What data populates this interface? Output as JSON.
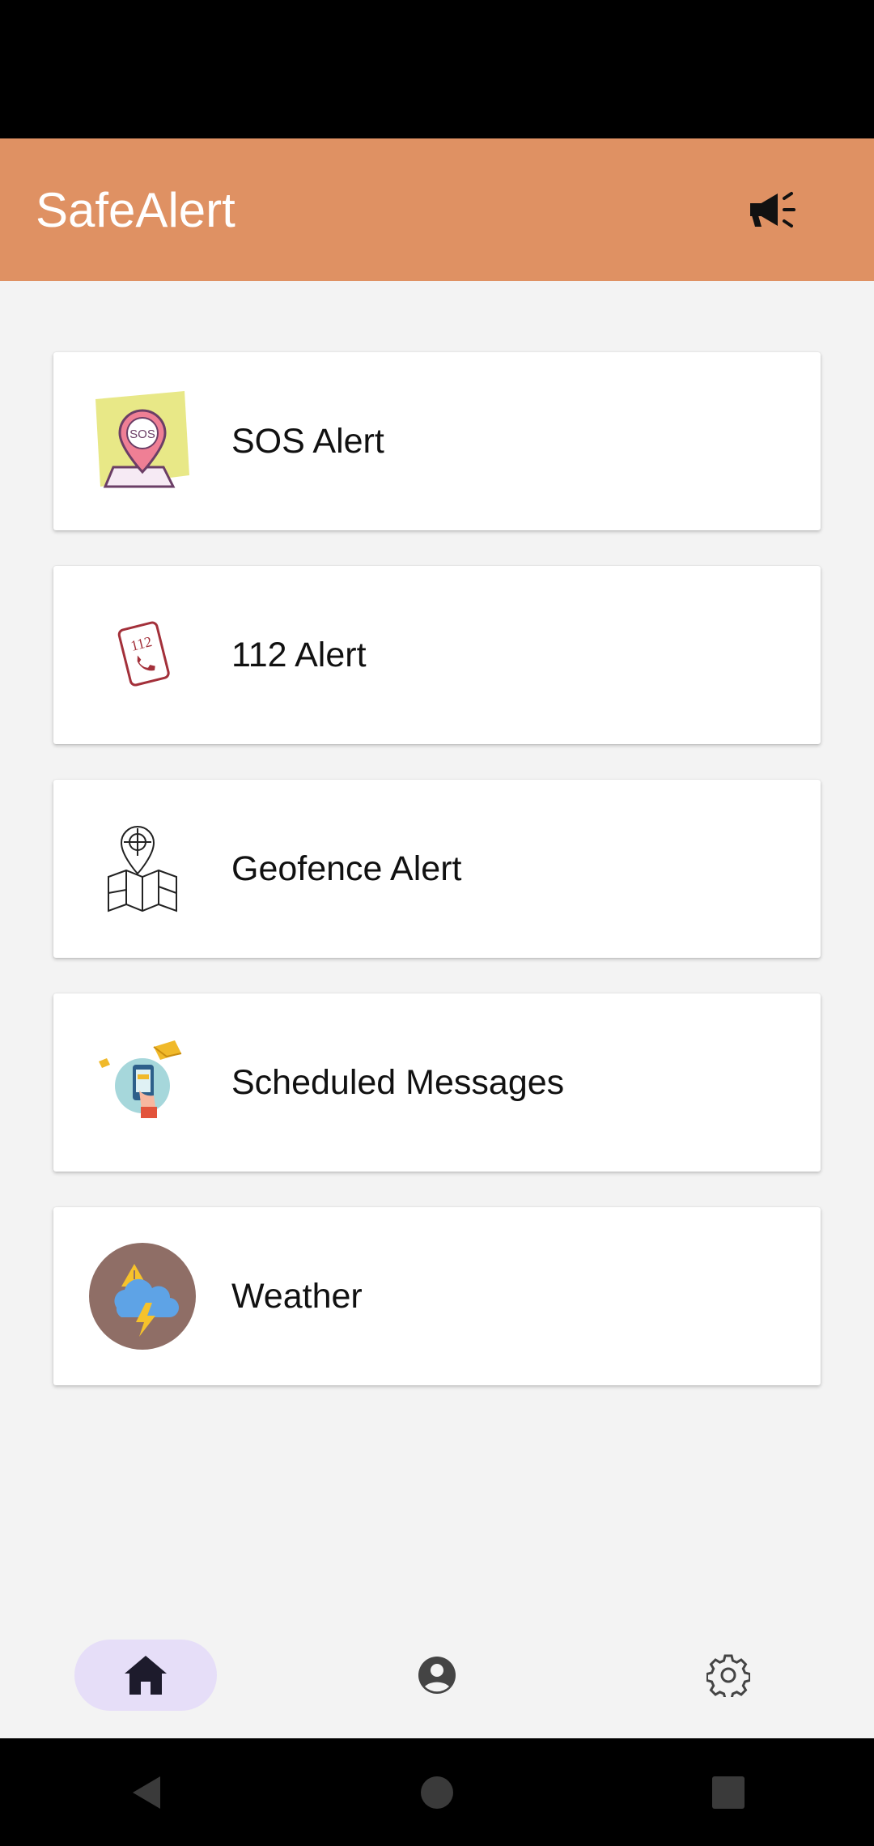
{
  "app_bar": {
    "title": "SafeAlert",
    "action_icon": "megaphone-icon",
    "background": "#df9163"
  },
  "cards": [
    {
      "label": "SOS Alert",
      "icon": "sos-location-icon"
    },
    {
      "label": "112 Alert",
      "icon": "phone-112-icon"
    },
    {
      "label": "Geofence Alert",
      "icon": "map-pin-icon"
    },
    {
      "label": "Scheduled Messages",
      "icon": "phone-message-icon"
    },
    {
      "label": "Weather",
      "icon": "weather-storm-icon"
    }
  ],
  "bottom_nav": {
    "items": [
      {
        "name": "home",
        "icon": "home-icon",
        "active": true
      },
      {
        "name": "profile",
        "icon": "account-circle-icon",
        "active": false
      },
      {
        "name": "settings",
        "icon": "gear-icon",
        "active": false
      }
    ],
    "active_color": "#e6def8"
  },
  "system_nav": [
    "back-icon",
    "home-circle-icon",
    "recents-icon"
  ]
}
